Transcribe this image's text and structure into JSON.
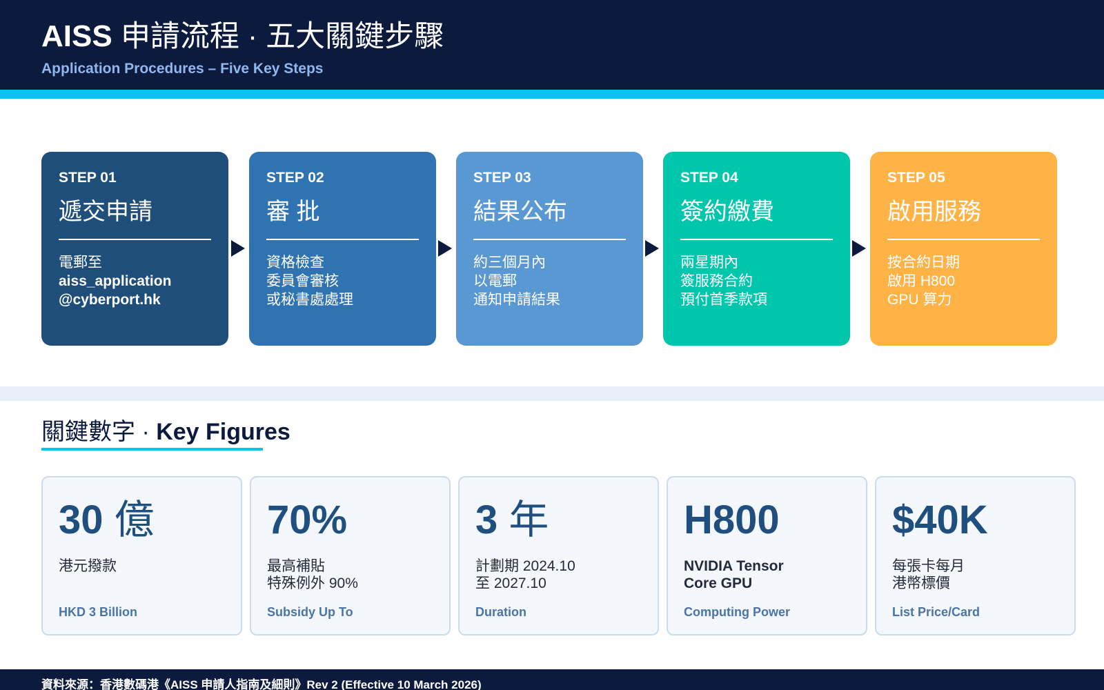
{
  "header": {
    "title_en": "AISS",
    "title_zh": "申請流程 · 五大關鍵步驟",
    "subtitle": "Application Procedures – Five Key Steps"
  },
  "steps": [
    {
      "label": "STEP 01",
      "title": "遞交申請",
      "lines": [
        "電郵至",
        "aiss_application",
        "@cyberport.hk"
      ],
      "color": "#1f4e7a"
    },
    {
      "label": "STEP 02",
      "title": "審 批",
      "lines": [
        "資格檢查",
        "委員會審核",
        "或秘書處處理"
      ],
      "color": "#2f73b3"
    },
    {
      "label": "STEP 03",
      "title": "結果公布",
      "lines": [
        "約三個月內",
        "以電郵",
        "通知申請結果"
      ],
      "color": "#5a98d3"
    },
    {
      "label": "STEP 04",
      "title": "簽約繳費",
      "lines": [
        "兩星期內",
        "簽服務合約",
        "預付首季款項"
      ],
      "color": "#00c7ab"
    },
    {
      "label": "STEP 05",
      "title": "啟用服務",
      "lines": [
        "按合約日期",
        "啟用 H800",
        "GPU 算力"
      ],
      "color": "#ffb347"
    }
  ],
  "key_figures": {
    "title_zh": "關鍵數字 · ",
    "title_en": "Key Figures",
    "items": [
      {
        "value": "30",
        "unit": " 億",
        "desc": [
          "港元撥款"
        ],
        "en": "HKD 3 Billion"
      },
      {
        "value": "70%",
        "unit": "",
        "desc": [
          "最高補貼",
          "特殊例外 90%"
        ],
        "en": "Subsidy Up To"
      },
      {
        "value": "3",
        "unit": " 年",
        "desc": [
          "計劃期 2024.10",
          "至 2027.10"
        ],
        "en": "Duration"
      },
      {
        "value": "H800",
        "unit": "",
        "desc": [
          "NVIDIA Tensor",
          "Core GPU"
        ],
        "en": "Computing Power"
      },
      {
        "value": "$40K",
        "unit": "",
        "desc": [
          "每張卡每月",
          "港幣標價"
        ],
        "en": "List Price/Card"
      }
    ]
  },
  "footer": {
    "source": "資料來源：香港數碼港《AISS 申請人指南及細則》Rev 2 (Effective 10 March 2026)"
  }
}
